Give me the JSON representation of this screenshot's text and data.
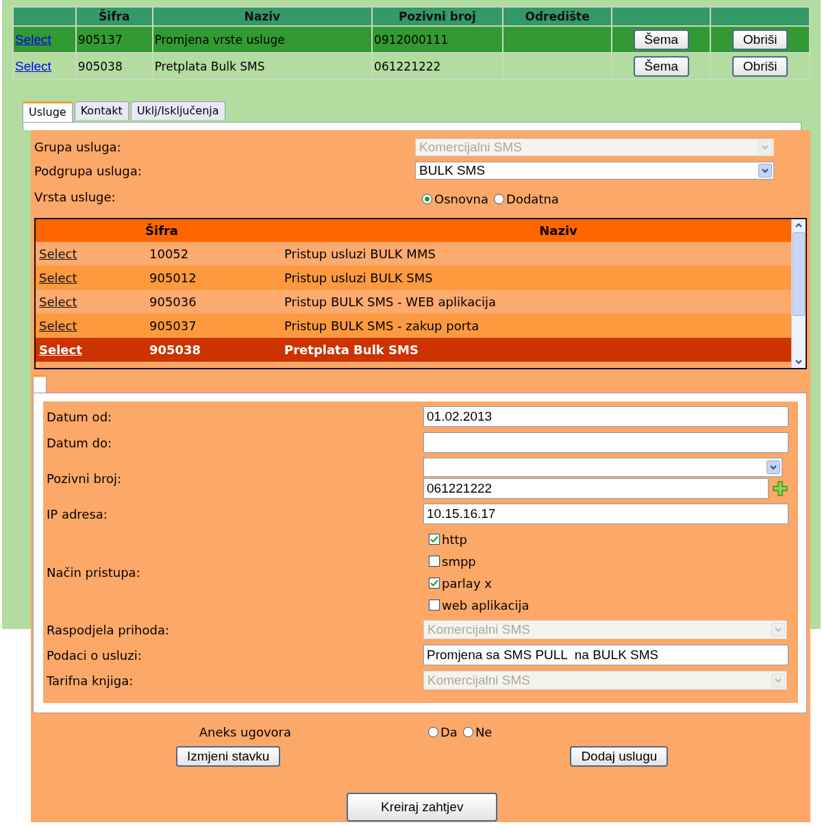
{
  "records": {
    "columns": [
      "Šifra",
      "Naziv",
      "Pozivni broj",
      "Odredište"
    ],
    "rows": [
      {
        "link": "Select",
        "code": "905137",
        "name": "Promjena vrste usluge",
        "number": "0912000111",
        "buttons": [
          "Šema",
          "Obriši"
        ],
        "selected": true
      },
      {
        "link": "Select",
        "code": "905038",
        "name": "Pretplata Bulk SMS",
        "number": "061221222",
        "buttons": [
          "Šema",
          "Obriši"
        ],
        "selected": false
      }
    ]
  },
  "tabs": [
    {
      "label": "Usluge",
      "selected": true
    },
    {
      "label": "Kontakt",
      "selected": false
    },
    {
      "label": "Uklj/Isključenja",
      "selected": false
    }
  ],
  "service": {
    "group": {
      "label": "Grupa usluga:",
      "value": "Komercijalni SMS",
      "disabled": true
    },
    "subgroup": {
      "label": "Podgrupa usluga:",
      "value": "BULK SMS",
      "disabled": false
    },
    "type": {
      "label": "Vrsta usluge:",
      "options": [
        {
          "label": "Osnovna",
          "selected": true
        },
        {
          "label": "Dodatna",
          "selected": false
        }
      ]
    }
  },
  "service_list": {
    "columns": [
      "Šifra",
      "Naziv"
    ],
    "rows": [
      {
        "link": "Select",
        "code": "10052",
        "name": "Pristup usluzi BULK MMS",
        "selected": false
      },
      {
        "link": "Select",
        "code": "905012",
        "name": "Pristup usluzi BULK SMS",
        "selected": false
      },
      {
        "link": "Select",
        "code": "905036",
        "name": "Pristup BULK SMS - WEB aplikacija",
        "selected": false
      },
      {
        "link": "Select",
        "code": "905037",
        "name": "Pristup BULK SMS - zakup porta",
        "selected": false
      },
      {
        "link": "Select",
        "code": "905038",
        "name": "Pretplata Bulk SMS",
        "selected": true
      }
    ]
  },
  "detail": {
    "fields": [
      {
        "kind": "input",
        "label": "Datum od:",
        "value": "01.02.2013"
      },
      {
        "kind": "input",
        "label": "Datum do:"
      },
      {
        "kind": "phone",
        "label": "Pozivni broj:",
        "value": "061221222"
      },
      {
        "kind": "input",
        "label": "IP adresa:",
        "value": "10.15.16.17"
      },
      {
        "kind": "checks",
        "label": "Način pristupa:",
        "options": [
          {
            "label": "http",
            "checked": true
          },
          {
            "label": "smpp",
            "checked": false
          },
          {
            "label": "parlay x",
            "checked": true
          },
          {
            "label": "web aplikacija",
            "checked": false
          }
        ]
      },
      {
        "kind": "select",
        "label": "Raspodjela prihoda:",
        "value": "Komercijalni SMS",
        "disabled": true
      },
      {
        "kind": "input",
        "label": "Podaci o usluzi:",
        "value": "Promjena sa SMS PULL  na BULK SMS"
      },
      {
        "kind": "select",
        "label": "Tarifna knjiga:",
        "value": "Komercijalni SMS",
        "disabled": true
      }
    ]
  },
  "annex": {
    "label": "Aneks ugovora",
    "options": [
      {
        "label": "Da",
        "selected": false
      },
      {
        "label": "Ne",
        "selected": false
      }
    ]
  },
  "buttons": [
    "Izmjeni stavku",
    "Dodaj uslugu"
  ],
  "submit": "Kreiraj zahtjev"
}
